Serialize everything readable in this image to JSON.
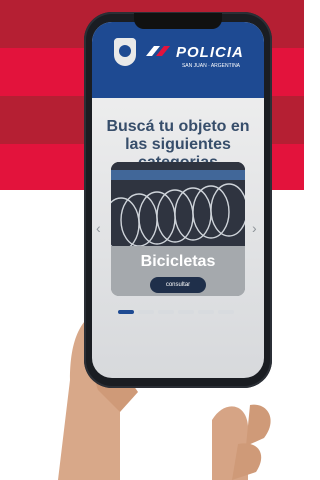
{
  "header": {
    "brand": "POLICIA",
    "subtitle": "SAN JUAN · ARGENTINA"
  },
  "content": {
    "heading": "Buscá tu objeto en las siguientes categorias",
    "carousel": {
      "title": "Bicicletas",
      "button": "consultar",
      "prev_icon": "‹",
      "next_icon": "›",
      "total_slides": 6,
      "active_slide": 1
    }
  },
  "colors": {
    "accent": "#1e4a92",
    "stripe_red": "#d41f3a",
    "button": "#1f2f4a"
  }
}
